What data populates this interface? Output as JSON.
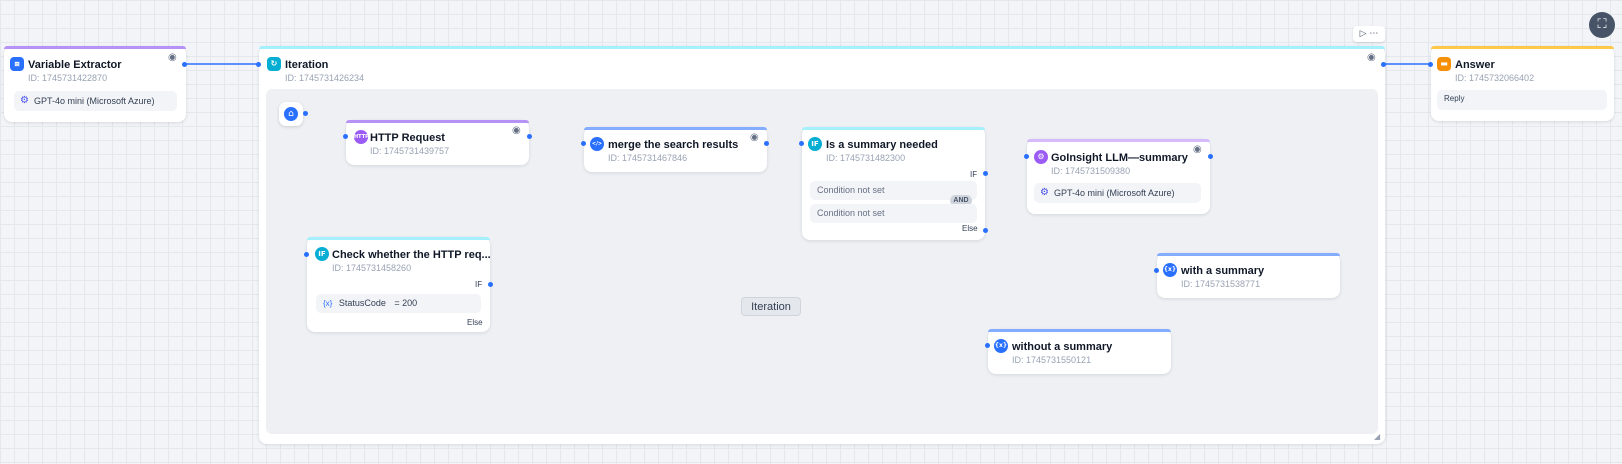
{
  "nodes": {
    "variable_extractor": {
      "title": "Variable Extractor",
      "id": "ID: 1745731422870",
      "model": "GPT-4o mini (Microsoft Azure)"
    },
    "iteration": {
      "title": "Iteration",
      "id": "ID: 1745731426234",
      "center_label": "Iteration"
    },
    "http_request": {
      "title": "HTTP Request",
      "id": "ID: 1745731439757"
    },
    "check_http": {
      "title": "Check whether the HTTP req...",
      "id": "ID: 1745731458260",
      "if_label": "IF",
      "else_label": "Else",
      "condition_var": "StatusCode",
      "condition_op": "= 200"
    },
    "merge": {
      "title": "merge the search results",
      "id": "ID: 1745731467846"
    },
    "summary_needed": {
      "title": "Is a summary needed",
      "id": "ID: 1745731482300",
      "if_label": "IF",
      "else_label": "Else",
      "condition1": "Condition not set",
      "condition2": "Condition not set",
      "logic": "AND"
    },
    "llm_summary": {
      "title": "GoInsight LLM—summary",
      "id": "ID: 1745731509380",
      "model": "GPT-4o mini (Microsoft Azure)"
    },
    "with_summary": {
      "title": "with a summary",
      "id": "ID: 1745731538771"
    },
    "without_summary": {
      "title": "without a summary",
      "id": "ID: 1745731550121"
    },
    "answer": {
      "title": "Answer",
      "id": "ID: 1745732066402",
      "reply": "Reply"
    }
  },
  "icons": {
    "variable_extractor": "variable-extractor-icon",
    "iteration": "iteration-icon",
    "http": "HTTP",
    "if": "IF",
    "code": "</>",
    "llm": "llm-icon",
    "variable": "{x}",
    "answer": "chat-bubble-icon"
  },
  "colors": {
    "accent": "#2970ff",
    "purple": "#9b5cf6",
    "cyan": "#06aed4",
    "blue_line": "#528bff",
    "orange": "#fdb022"
  }
}
